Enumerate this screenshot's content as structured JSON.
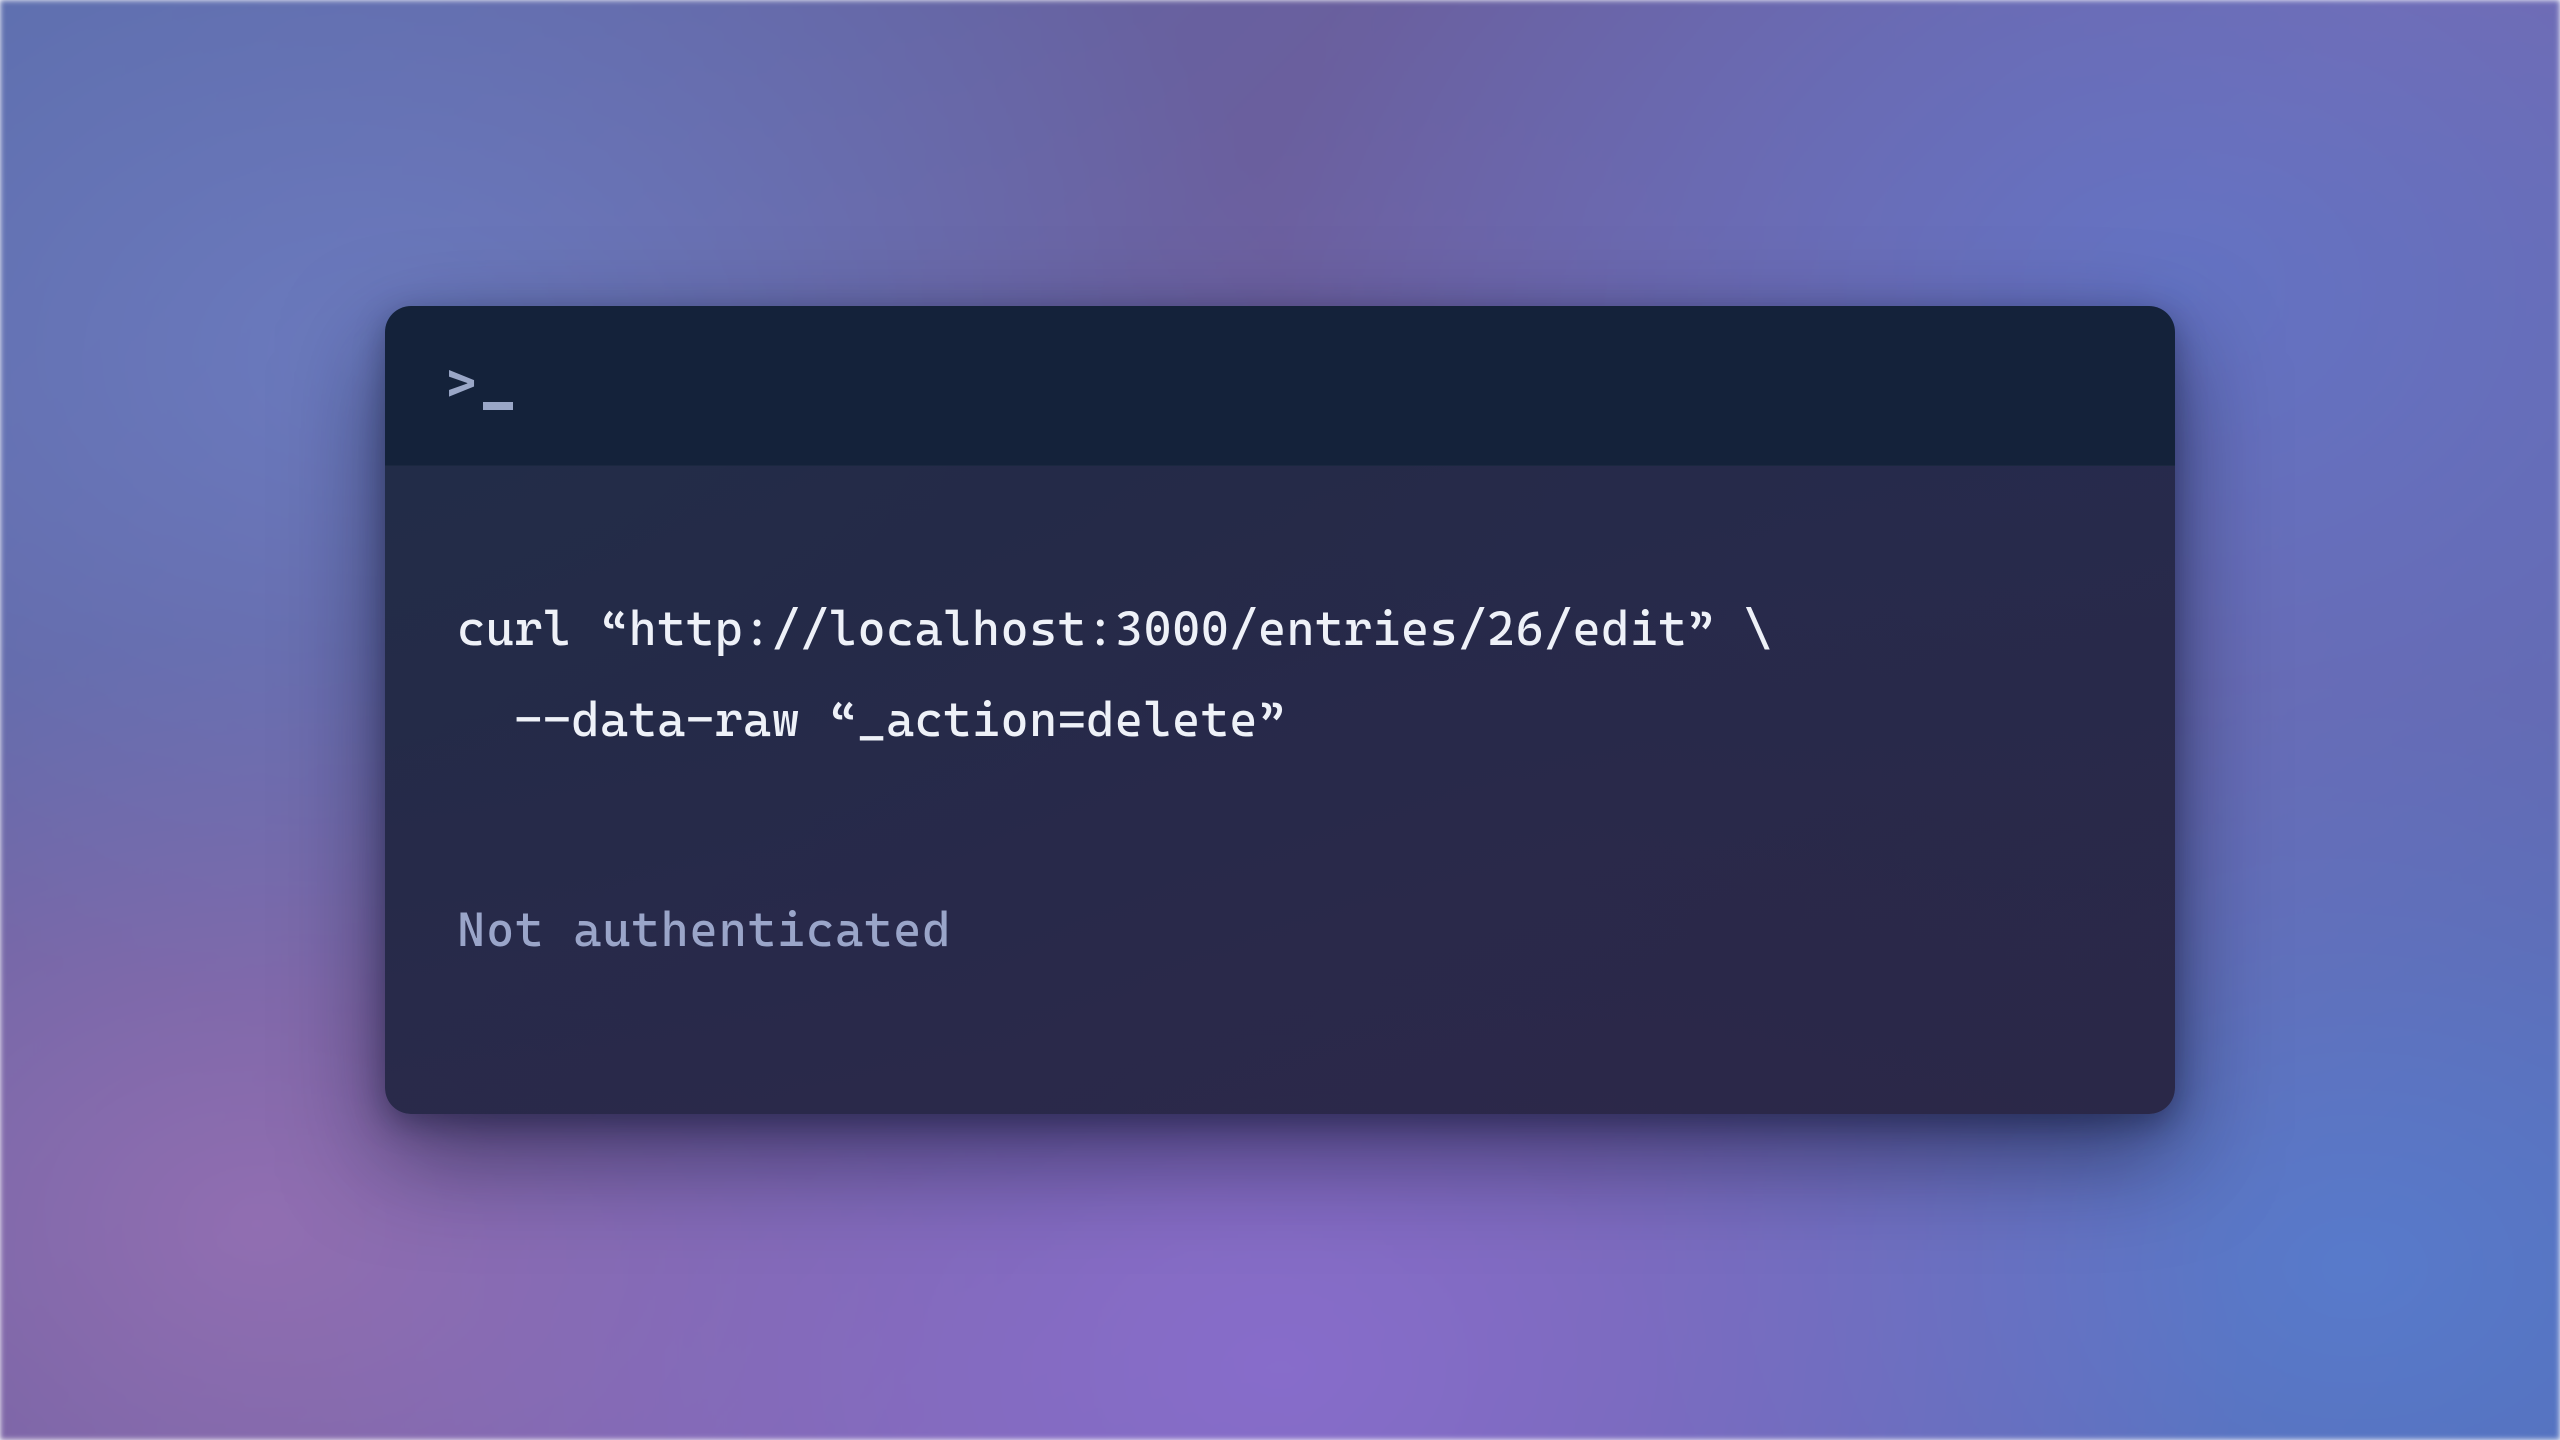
{
  "terminal": {
    "prompt_glyph": ">",
    "command_line_1": "curl “http://localhost:3000/entries/26/edit” \\",
    "command_line_2": "  --data-raw “_action=delete”",
    "output": "Not authenticated"
  }
}
